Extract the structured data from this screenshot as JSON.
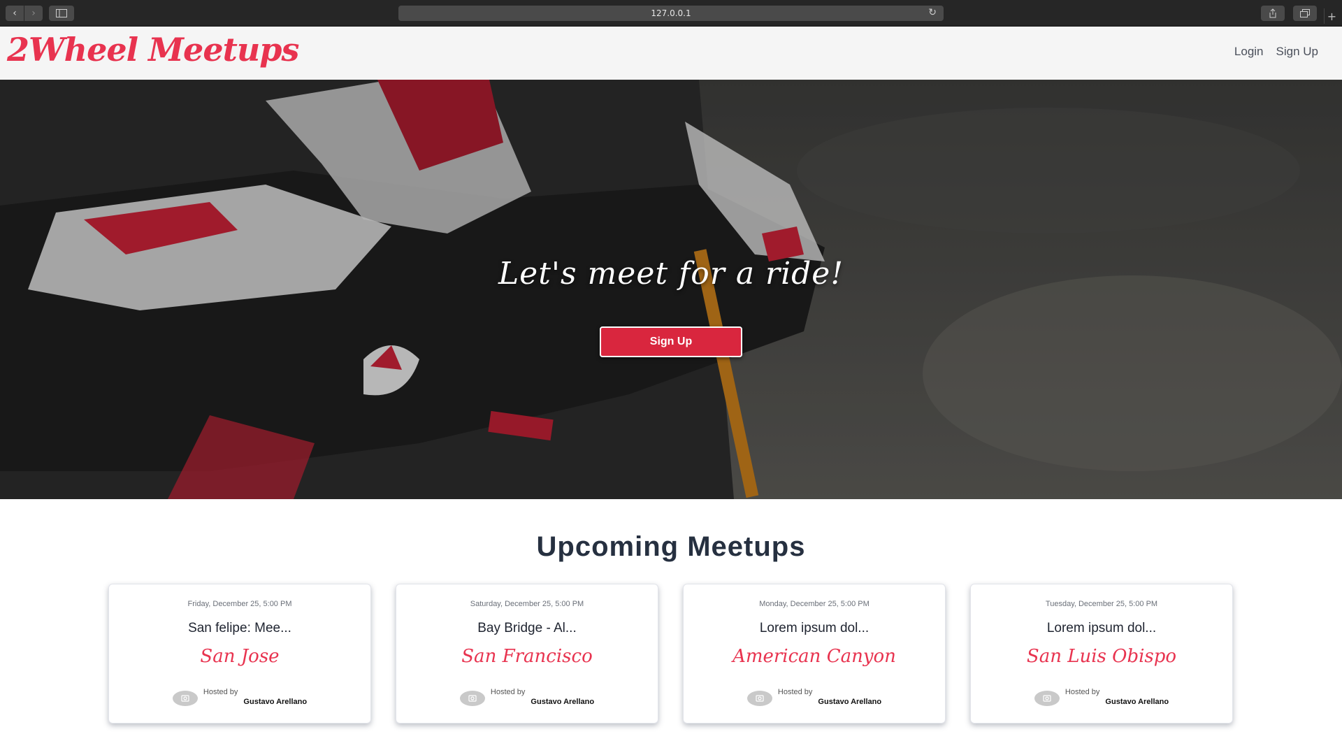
{
  "browser": {
    "address": "127.0.0.1"
  },
  "navbar": {
    "logo": "2Wheel Meetups",
    "links": [
      "Login",
      "Sign Up"
    ]
  },
  "hero": {
    "title": "Let's meet for a ride!",
    "signup_label": "Sign Up"
  },
  "meetups": {
    "heading": "Upcoming Meetups",
    "cards": [
      {
        "date": "Friday, December 25, 5:00 PM",
        "title": "San felipe: Mee...",
        "city": "San Jose",
        "hosted_label": "Hosted by",
        "host": "Gustavo Arellano"
      },
      {
        "date": "Saturday, December 25, 5:00 PM",
        "title": "Bay Bridge - Al...",
        "city": "San Francisco",
        "hosted_label": "Hosted by",
        "host": "Gustavo Arellano"
      },
      {
        "date": "Monday, December 25, 5:00 PM",
        "title": "Lorem ipsum dol...",
        "city": "American Canyon",
        "hosted_label": "Hosted by",
        "host": "Gustavo Arellano"
      },
      {
        "date": "Tuesday, December 25, 5:00 PM",
        "title": "Lorem ipsum dol...",
        "city": "San Luis Obispo",
        "hosted_label": "Hosted by",
        "host": "Gustavo Arellano"
      }
    ]
  },
  "colors": {
    "brand": "#e8334f",
    "button": "#d9263e",
    "heading": "#263040"
  }
}
